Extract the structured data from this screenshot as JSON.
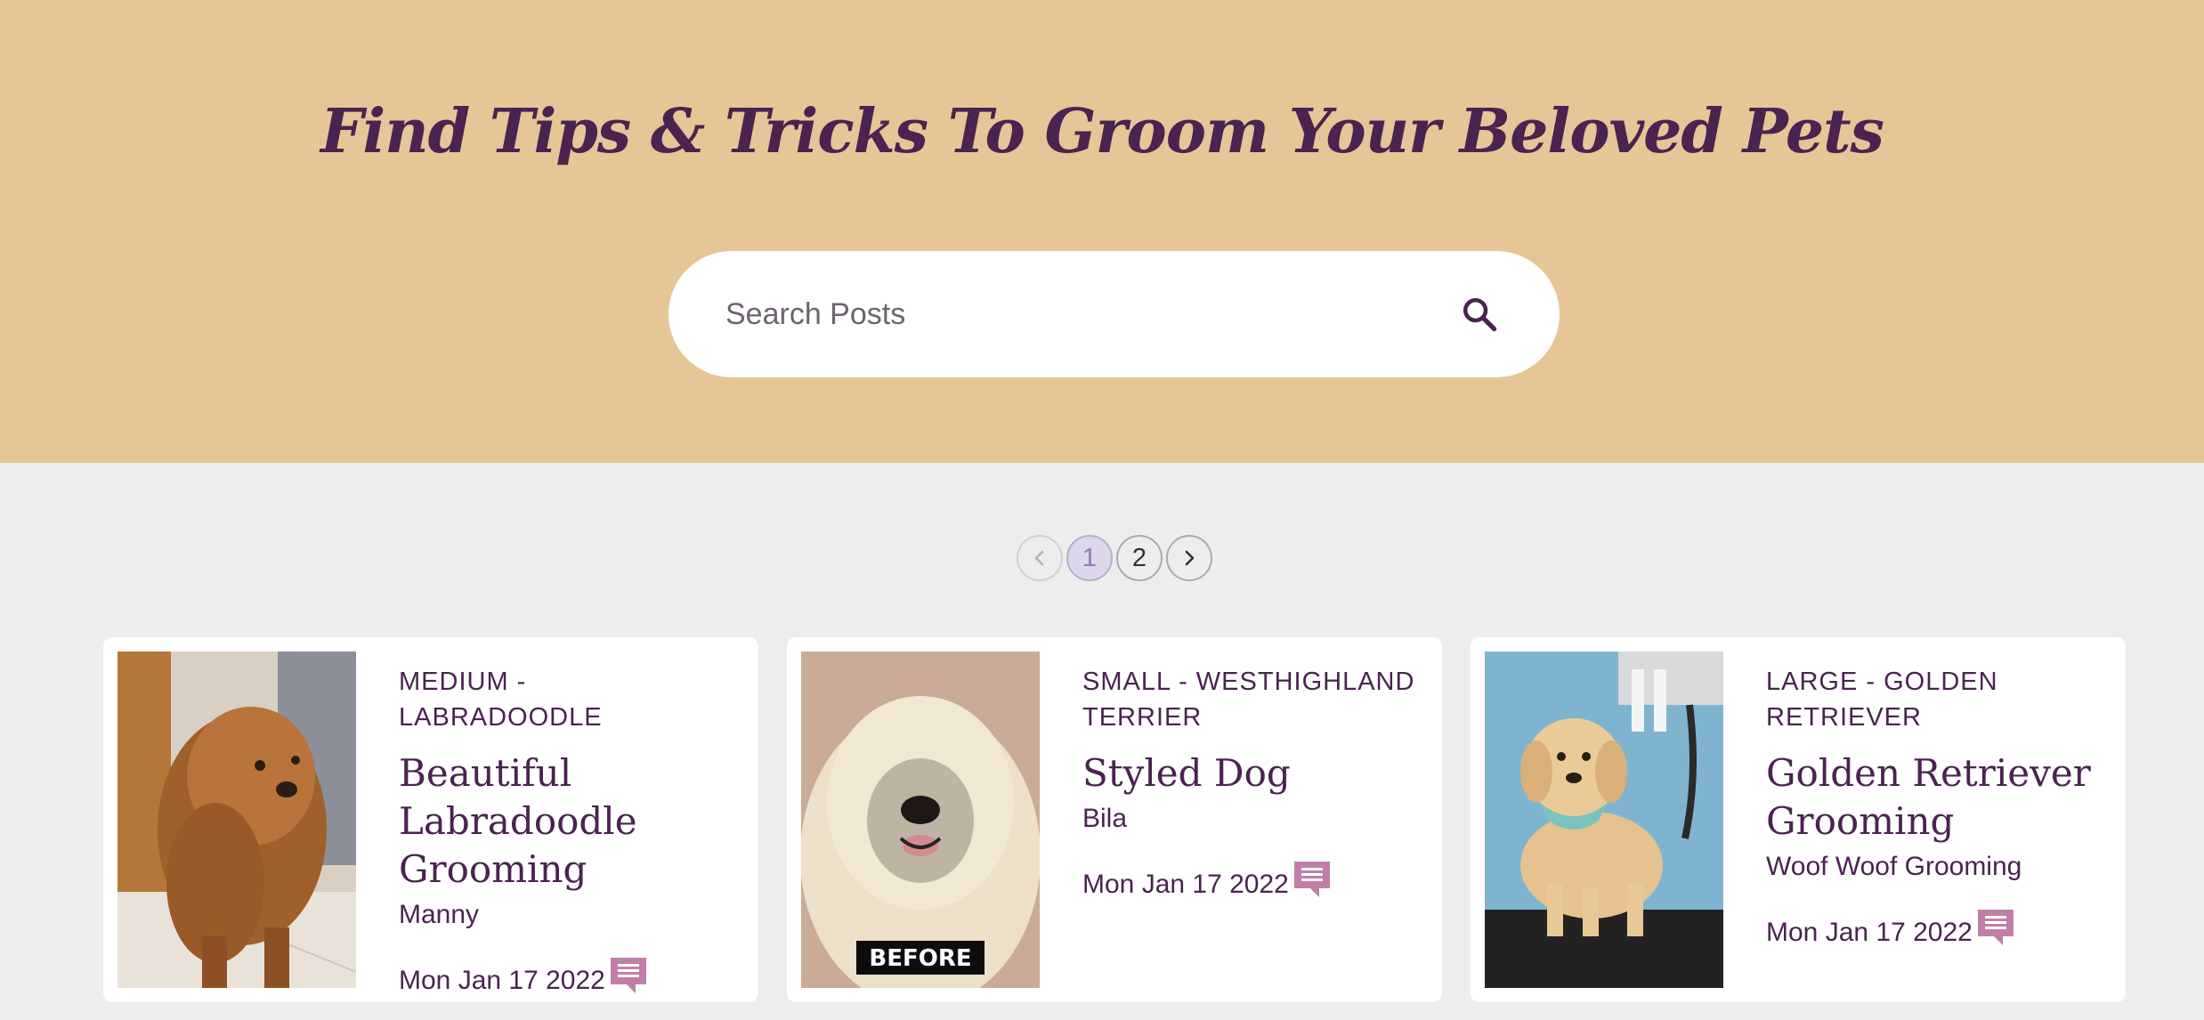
{
  "hero": {
    "title": "Find Tips & Tricks To Groom Your Beloved Pets",
    "background": "#e6c597"
  },
  "search": {
    "placeholder": "Search Posts",
    "icon": "search-icon"
  },
  "pagination": {
    "prev_icon": "chevron-left-icon",
    "next_icon": "chevron-right-icon",
    "pages": [
      "1",
      "2"
    ],
    "current": "1"
  },
  "posts": [
    {
      "category": "MEDIUM - LABRADOODLE",
      "title": "Beautiful Labradoodle Grooming",
      "author": "Manny",
      "date": "Mon Jan 17 2022",
      "comment_icon": "comment-icon"
    },
    {
      "category": "SMALL - WESTHIGHLAND TERRIER",
      "title": "Styled Dog",
      "author": "Bila",
      "date": "Mon Jan 17 2022",
      "badge": "BEFORE",
      "comment_icon": "comment-icon"
    },
    {
      "category": "LARGE - GOLDEN RETRIEVER",
      "title": "Golden Retriever Grooming",
      "author": "Woof Woof Grooming",
      "date": "Mon Jan 17 2022",
      "comment_icon": "comment-icon"
    }
  ],
  "colors": {
    "brand_purple": "#4a2350",
    "comment_pink": "#c07fa9",
    "page_bg": "#ededed"
  }
}
